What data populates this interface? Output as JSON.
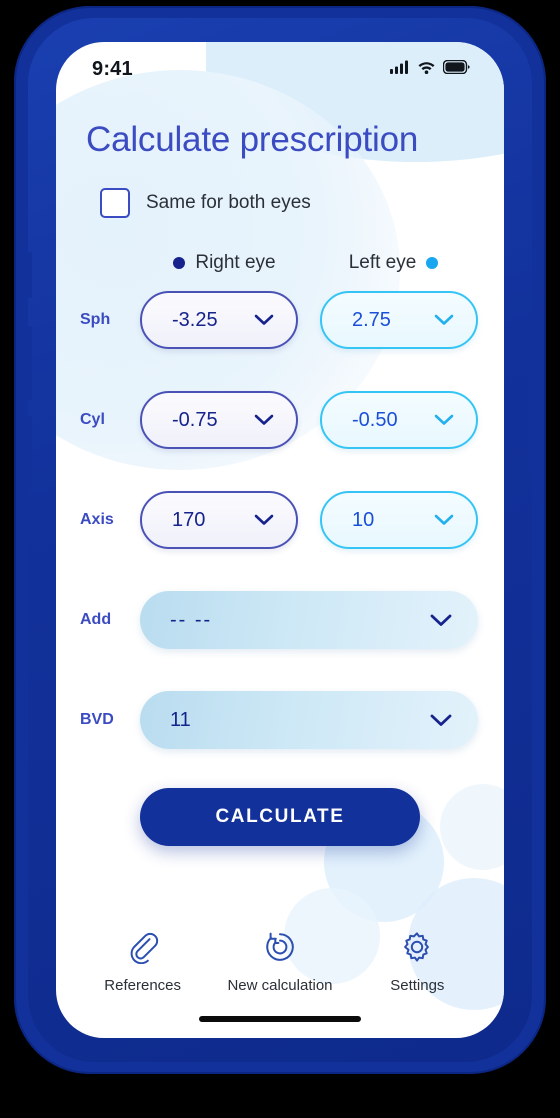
{
  "status_bar": {
    "time": "9:41",
    "icons": [
      "cellular-signal-icon",
      "wifi-icon",
      "battery-icon"
    ]
  },
  "header": {
    "title": "Calculate prescription"
  },
  "same_for_both_eyes": {
    "label": "Same for both eyes",
    "checked": false
  },
  "eye_columns": [
    {
      "label": "Right eye",
      "dot_color": "#16238c",
      "dot_position": "left"
    },
    {
      "label": "Left eye",
      "dot_color": "#17a6ef",
      "dot_position": "right"
    }
  ],
  "form_rows": [
    {
      "label": "Sph",
      "type": "split",
      "right_value": "-3.25",
      "left_value": "2.75"
    },
    {
      "label": "Cyl",
      "type": "split",
      "right_value": "-0.75",
      "left_value": "-0.50"
    },
    {
      "label": "Axis",
      "type": "split",
      "right_value": "170",
      "left_value": "10"
    },
    {
      "label": "Add",
      "type": "wide",
      "value": "-- --",
      "is_placeholder": true
    },
    {
      "label": "BVD",
      "type": "wide",
      "value": "11",
      "is_placeholder": false
    }
  ],
  "primary_action": {
    "label": "CALCULATE"
  },
  "bottom_nav": [
    {
      "label": "References",
      "icon": "paperclip-icon"
    },
    {
      "label": "New calculation",
      "icon": "refresh-circle-icon"
    },
    {
      "label": "Settings",
      "icon": "gear-icon"
    }
  ],
  "colors": {
    "brand_navy": "#12319b",
    "title_blue": "#3b4bc2",
    "right_eye_accent": "#16238c",
    "left_eye_accent": "#17a6ef",
    "decor_light_blue": "#ddeefb"
  }
}
